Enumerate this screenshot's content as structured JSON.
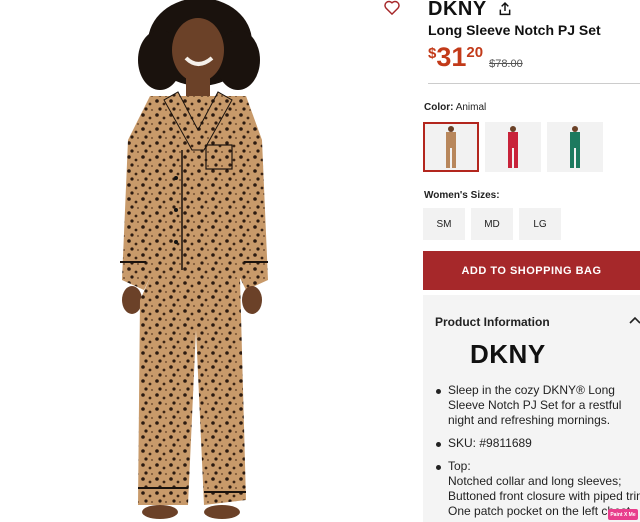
{
  "product": {
    "brand": "DKNY",
    "name": "Long Sleeve Notch PJ Set",
    "price_dollar_sign": "$",
    "price_main": "31",
    "price_cents": "20",
    "price_original": "$78.00"
  },
  "icons": {
    "favorite": "heart-icon",
    "share": "share-icon",
    "collapse": "chevron-up-icon"
  },
  "color": {
    "label": "Color:",
    "value": "Animal",
    "swatches": [
      {
        "name": "Animal",
        "color": "#b8875c",
        "selected": true
      },
      {
        "name": "Red",
        "color": "#c8233a",
        "selected": false
      },
      {
        "name": "Green",
        "color": "#1d7a5f",
        "selected": false
      }
    ]
  },
  "sizes": {
    "label": "Women's Sizes:",
    "options": [
      "SM",
      "MD",
      "LG"
    ]
  },
  "cart": {
    "add_label": "ADD TO SHOPPING BAG"
  },
  "info": {
    "title": "Product Information",
    "logo": "DKNY",
    "bullets": [
      "Sleep in the cozy DKNY® Long Sleeve Notch PJ Set for a restful night and refreshing mornings.",
      "SKU: #9811689"
    ],
    "top_heading": "Top:",
    "top_lines": [
      "Notched collar and long sleeves;",
      "Buttoned front closure with piped trim;",
      "One patch pocket on the left chest."
    ]
  },
  "badge": {
    "label": "Paint X Me"
  },
  "colors": {
    "accent": "#a6282a",
    "price": "#c23a19",
    "panel": "#f4f4f4"
  }
}
